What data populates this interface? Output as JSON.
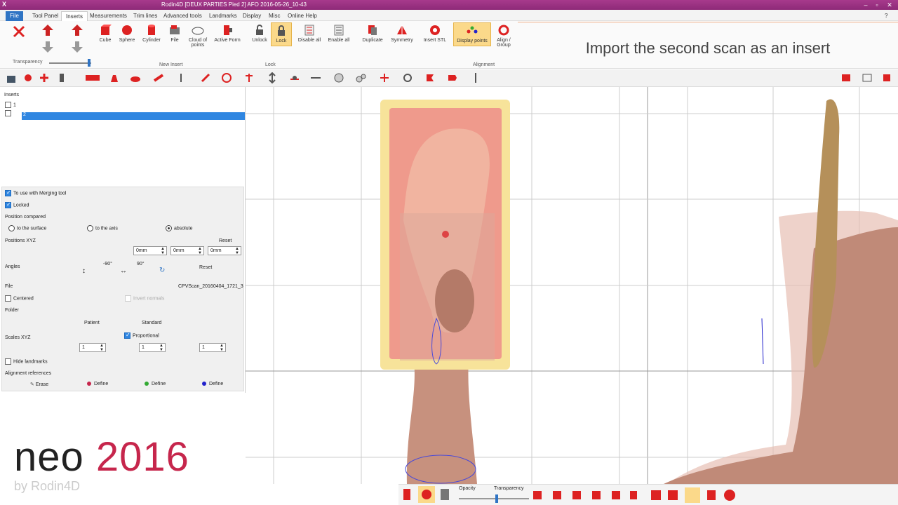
{
  "window": {
    "title": "Rodin4D [DEUX PARTIES Pied 2] AFO 2016-05-26_10-43",
    "app_icon": "X"
  },
  "menu": [
    "File",
    "Tool Panel",
    "Inserts",
    "Measurements",
    "Trim lines",
    "Advanced tools",
    "Landmarks",
    "Display",
    "Misc",
    "Online Help"
  ],
  "ribbon": {
    "buttons": [
      "Cube",
      "Sphere",
      "Cylinder",
      "File",
      "Cloud of points",
      "Active Form",
      "Unlock",
      "Lock",
      "Disable all",
      "Enable all",
      "Duplicate",
      "Symmetry",
      "Insert STL",
      "Display points",
      "Align / Group"
    ],
    "groups": {
      "new_insert": "New Insert",
      "lock": "Lock",
      "alignment": "Alignment"
    },
    "transparency_label": "Transparency",
    "transparency_value": 0.95
  },
  "banner": "Import the second scan as an insert",
  "panel": {
    "inserts_title": "Inserts",
    "items": [
      "1",
      "2"
    ],
    "merging": "To use with Merging tool",
    "locked": "Locked",
    "position_compared": "Position compared",
    "pos_options": [
      "to the surface",
      "to the axis",
      "absolute"
    ],
    "positions_xyz": "Positions XYZ",
    "reset": "Reset",
    "pos_values": [
      "0mm",
      "0mm",
      "0mm"
    ],
    "angles": "Angles",
    "angle_a": "-90°",
    "angle_b": "90°",
    "file_label": "File",
    "file_value": "CPVScan_20160404_1721_3",
    "centered": "Centered",
    "invert_normals": "Invert normals",
    "folder": "Folder",
    "patient": "Patient",
    "standard": "Standard",
    "proportional": "Proportional",
    "scales_xyz": "Scales XYZ",
    "scales": [
      "1",
      "1",
      "1"
    ],
    "hide_landmarks": "Hide landmarks",
    "alignment_refs": "Alignment references",
    "erase": "Erase",
    "define": "Define"
  },
  "bottom": {
    "opacity": "Opacity",
    "transparency": "Transparency"
  },
  "logo": {
    "neo": "neo",
    "year": "2016",
    "by": "by Rodin4D"
  },
  "colors": {
    "accent": "#2f86e1",
    "title": "#9a3283",
    "logo_red": "#c6264c"
  }
}
